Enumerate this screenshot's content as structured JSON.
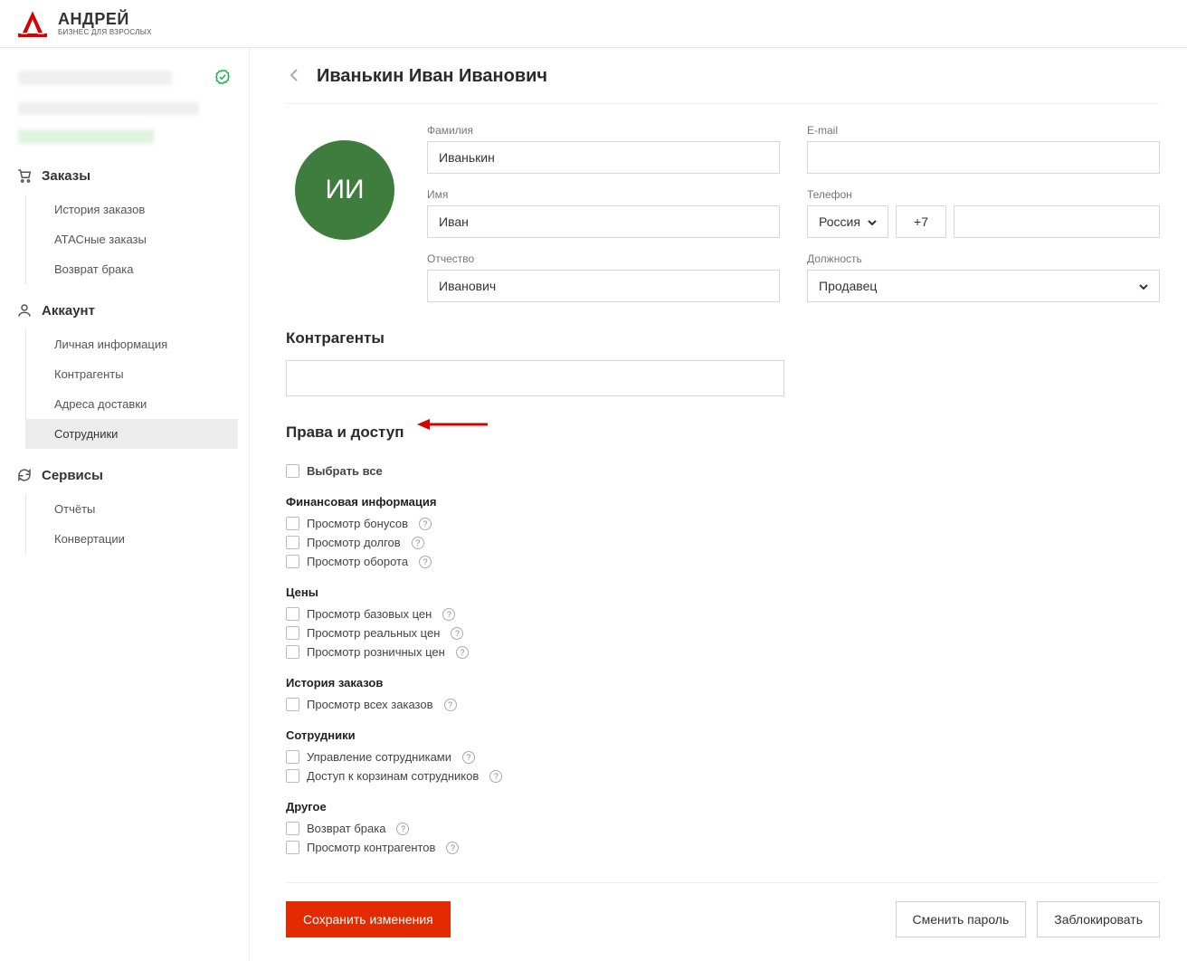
{
  "brand": {
    "name": "АНДРЕЙ",
    "tagline": "БИЗНЕС ДЛЯ ВЗРОСЛЫХ"
  },
  "sidebar": {
    "sections": [
      {
        "title": "Заказы",
        "icon": "cart-icon",
        "items": [
          "История заказов",
          "АТАСные заказы",
          "Возврат брака"
        ]
      },
      {
        "title": "Аккаунт",
        "icon": "user-icon",
        "items": [
          "Личная информация",
          "Контрагенты",
          "Адреса доставки",
          "Сотрудники"
        ],
        "activeIndex": 3
      },
      {
        "title": "Сервисы",
        "icon": "refresh-icon",
        "items": [
          "Отчёты",
          "Конвертации"
        ]
      }
    ]
  },
  "page": {
    "title": "Иванькин Иван Иванович",
    "avatar_initials": "ИИ",
    "labels": {
      "lastname": "Фамилия",
      "firstname": "Имя",
      "middlename": "Отчество",
      "email": "E-mail",
      "phone": "Телефон",
      "role": "Должность"
    },
    "values": {
      "lastname": "Иванькин",
      "firstname": "Иван",
      "middlename": "Иванович",
      "email": "",
      "phone_country": "Россия",
      "phone_code": "+7",
      "phone_number": "",
      "role": "Продавец"
    },
    "contragents_title": "Контрагенты",
    "permissions_title": "Права и доступ",
    "select_all": "Выбрать все",
    "perm_groups": [
      {
        "title": "Финансовая информация",
        "items": [
          "Просмотр бонусов",
          "Просмотр долгов",
          "Просмотр оборота"
        ]
      },
      {
        "title": "Цены",
        "items": [
          "Просмотр базовых цен",
          "Просмотр реальных цен",
          "Просмотр розничных цен"
        ]
      },
      {
        "title": "История заказов",
        "items": [
          "Просмотр всех заказов"
        ]
      },
      {
        "title": "Сотрудники",
        "items": [
          "Управление сотрудниками",
          "Доступ к корзинам сотрудников"
        ]
      },
      {
        "title": "Другое",
        "items": [
          "Возврат брака",
          "Просмотр контрагентов"
        ]
      }
    ],
    "buttons": {
      "save": "Сохранить изменения",
      "change_password": "Сменить пароль",
      "block": "Заблокировать"
    }
  }
}
